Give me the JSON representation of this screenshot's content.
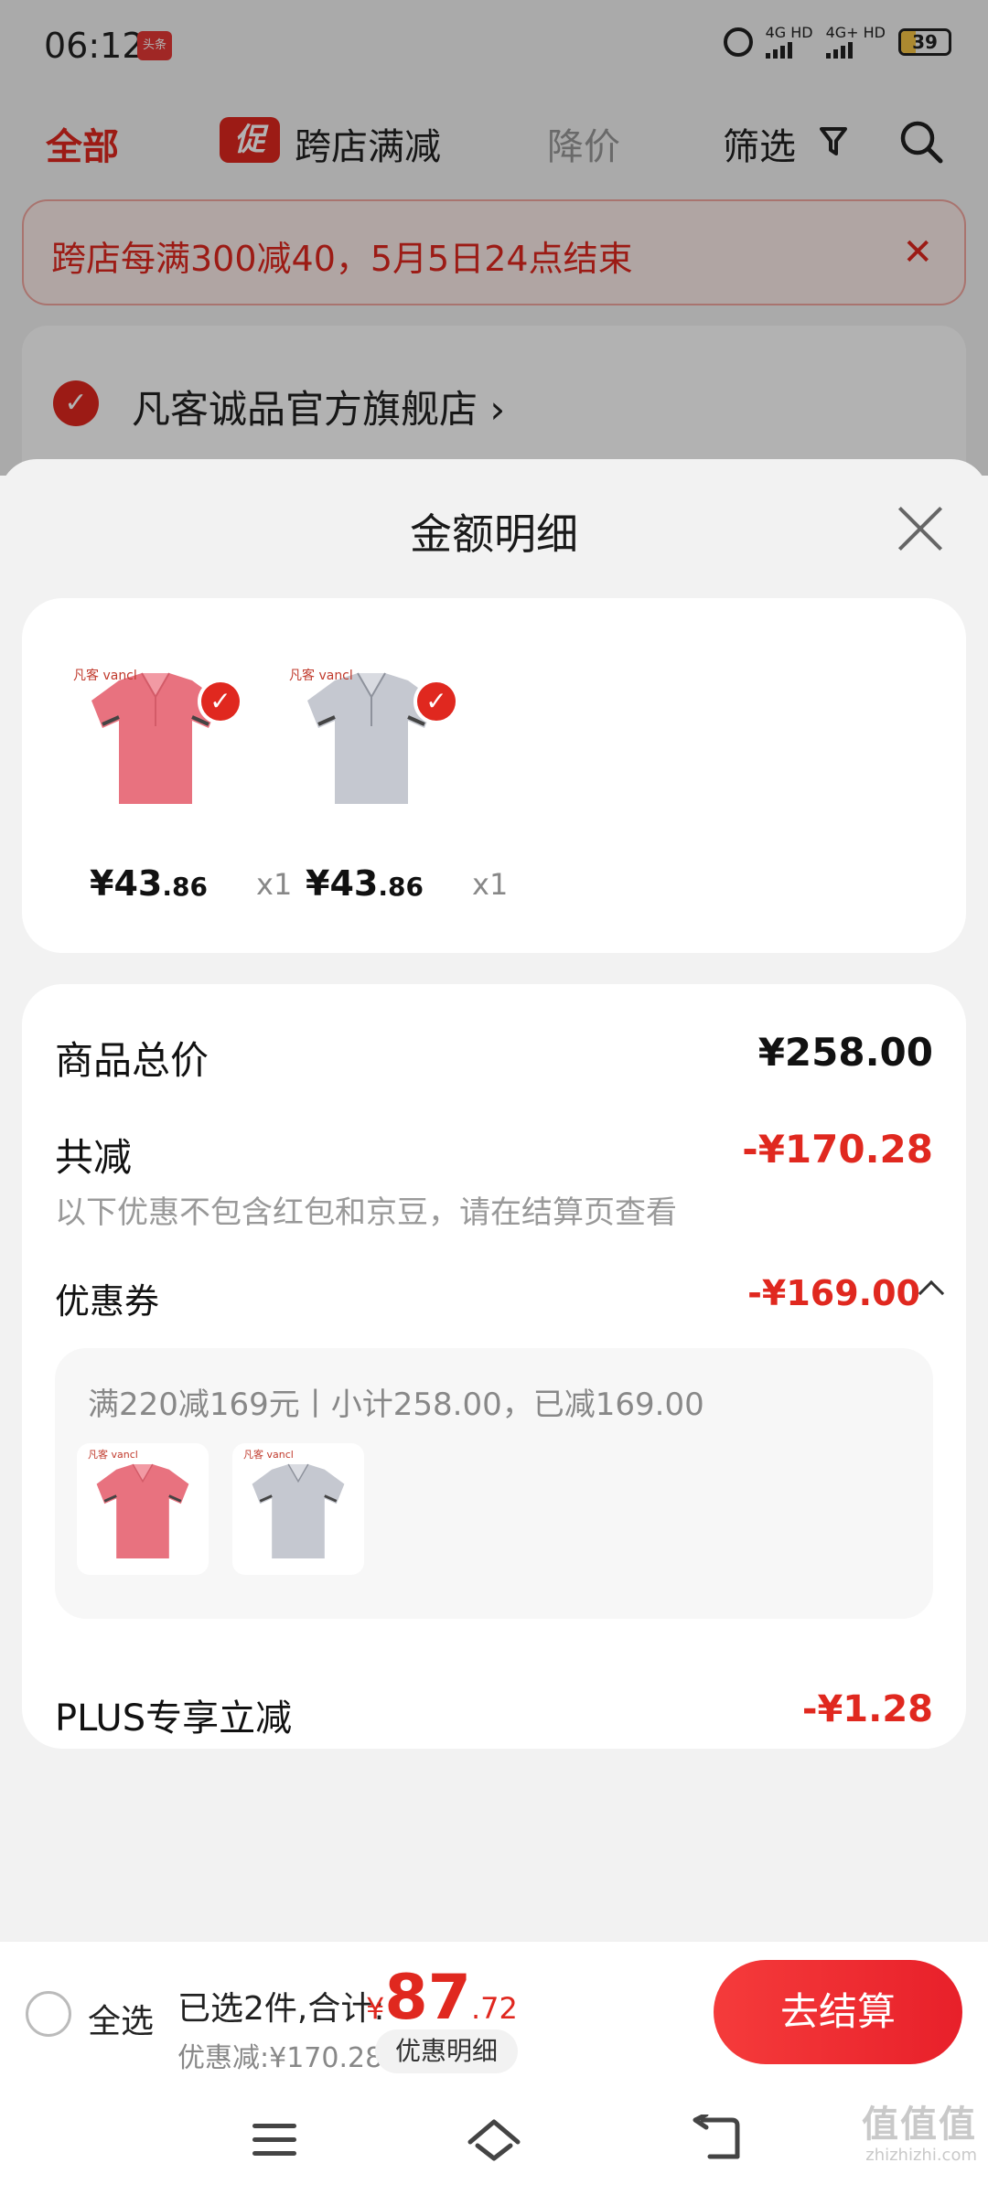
{
  "status_bar": {
    "time": "06:12",
    "app_badge": "头条",
    "net1": "4G HD",
    "net2": "4G+ HD",
    "battery": "39"
  },
  "top_nav": {
    "all": "全部",
    "promo_badge": "促",
    "promo": "跨店满减",
    "price_drop": "降价",
    "filter": "筛选"
  },
  "promo_banner": {
    "text": "跨店每满300减40，5月5日24点结束",
    "close": "✕"
  },
  "store": {
    "name": "凡客诚品官方旗舰店",
    "chevron": "›"
  },
  "sheet": {
    "title": "金额明细",
    "products": [
      {
        "brand": "凡客 vancl",
        "color": "pink",
        "price_int": "¥43",
        "price_dec": ".86",
        "qty": "x1"
      },
      {
        "brand": "凡客 vancl",
        "color": "grey",
        "price_int": "¥43",
        "price_dec": ".86",
        "qty": "x1"
      }
    ],
    "goods_total_label": "商品总价",
    "goods_total_value": "¥258.00",
    "total_reduce_label": "共减",
    "total_reduce_value": "-¥170.28",
    "reduce_note": "以下优惠不包含红包和京豆，请在结算页查看",
    "coupon_label": "优惠券",
    "coupon_value": "-¥169.00",
    "coupon_detail": "满220减169元丨小计258.00，已减169.00",
    "plus_label": "PLUS专享立减",
    "plus_value": "-¥1.28"
  },
  "checkout": {
    "select_all": "全选",
    "selected": "已选2件,合计:",
    "total_cur": "¥",
    "total_int": "87",
    "total_dec": ".72",
    "discount": "优惠减:¥170.28",
    "detail_pill": "优惠明细",
    "button": "去结算"
  },
  "watermark": {
    "main": "值值值",
    "sub": "zhizhizhi.com"
  },
  "colors": {
    "accent": "#e0281f",
    "pink_shirt": "#e8727f",
    "grey_shirt": "#c5c8d0"
  }
}
